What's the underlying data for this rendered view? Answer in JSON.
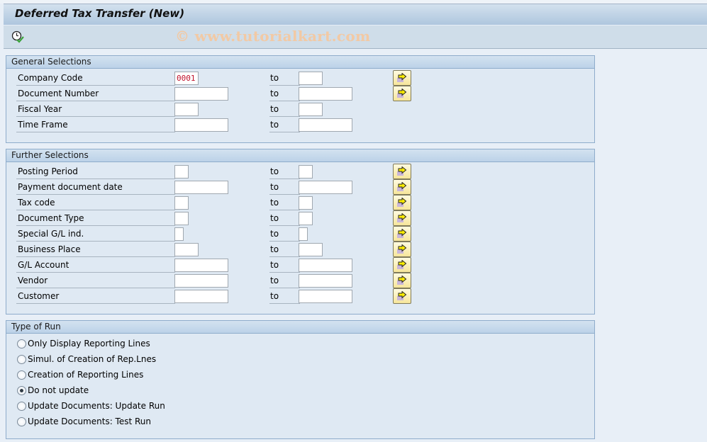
{
  "window": {
    "title": "Deferred Tax Transfer (New)"
  },
  "toolbar": {
    "execute_icon": "execute-clock-icon",
    "watermark": "© www.tutorialkart.com"
  },
  "general_selections": {
    "title": "General Selections",
    "to_label": "to",
    "rows": [
      {
        "label": "Company Code",
        "from": "0001",
        "to": "",
        "has_multi": true
      },
      {
        "label": "Document Number",
        "from": "",
        "to": "",
        "has_multi": true
      },
      {
        "label": "Fiscal Year",
        "from": "",
        "to": "",
        "has_multi": false
      },
      {
        "label": "Time Frame",
        "from": "",
        "to": "",
        "has_multi": false
      }
    ]
  },
  "further_selections": {
    "title": "Further Selections",
    "to_label": "to",
    "rows": [
      {
        "label": "Posting Period",
        "from": "",
        "to": "",
        "has_multi": true
      },
      {
        "label": "Payment document date",
        "from": "",
        "to": "",
        "has_multi": true
      },
      {
        "label": "Tax code",
        "from": "",
        "to": "",
        "has_multi": true
      },
      {
        "label": "Document Type",
        "from": "",
        "to": "",
        "has_multi": true
      },
      {
        "label": "Special G/L ind.",
        "from": "",
        "to": "",
        "has_multi": true
      },
      {
        "label": "Business Place",
        "from": "",
        "to": "",
        "has_multi": true
      },
      {
        "label": "G/L Account",
        "from": "",
        "to": "",
        "has_multi": true
      },
      {
        "label": "Vendor",
        "from": "",
        "to": "",
        "has_multi": true
      },
      {
        "label": "Customer",
        "from": "",
        "to": "",
        "has_multi": true
      }
    ]
  },
  "type_of_run": {
    "title": "Type of Run",
    "selected": "Do not update",
    "options": [
      {
        "label": "Only Display Reporting Lines",
        "checked": false
      },
      {
        "label": "Simul. of Creation of Rep.Lnes",
        "checked": false
      },
      {
        "label": "Creation of Reporting Lines",
        "checked": false
      },
      {
        "label": "Do not update",
        "checked": true
      },
      {
        "label": "Update Documents: Update Run",
        "checked": false
      },
      {
        "label": "Update Documents: Test Run",
        "checked": false
      }
    ]
  },
  "icons": {
    "multiple_selection": "multiple-selection-arrow-icon"
  }
}
